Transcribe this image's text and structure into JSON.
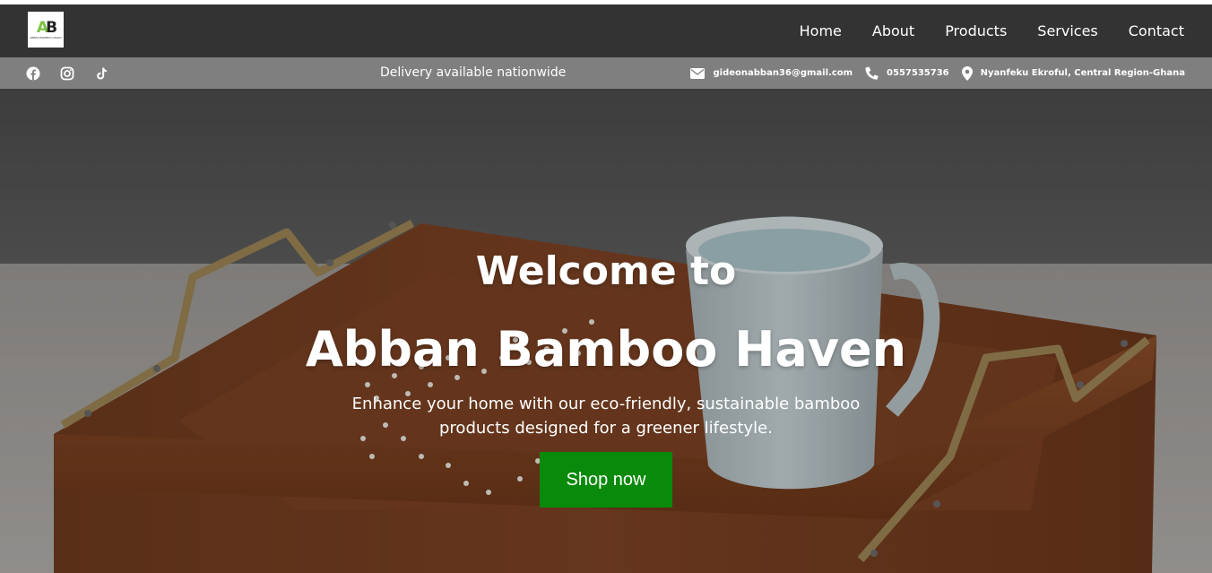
{
  "header": {
    "logo": {
      "mark_left": "A",
      "mark_right": "B",
      "text": "Abban Bamboo Haven"
    },
    "nav": [
      {
        "label": "Home"
      },
      {
        "label": "About"
      },
      {
        "label": "Products"
      },
      {
        "label": "Services"
      },
      {
        "label": "Contact"
      }
    ]
  },
  "infobar": {
    "social_icons": [
      "facebook-icon",
      "instagram-icon",
      "tiktok-icon"
    ],
    "delivery_text": "Delivery available nationwide",
    "email": "gideonabban36@gmail.com",
    "phone": "0557535736",
    "location": "Nyanfeku Ekroful, Central Region-Ghana"
  },
  "hero": {
    "title_line1": "Welcome to",
    "title_line2": "Abban Bamboo Haven",
    "subtitle": "Enhance your home with our eco-friendly, sustainable bamboo products designed for a greener lifestyle.",
    "cta_label": "Shop now"
  },
  "colors": {
    "header_bg": "#333333",
    "infobar_bg": "#7f7f7f",
    "cta_bg": "#0a8a0a",
    "logo_accent": "#7cc241"
  }
}
